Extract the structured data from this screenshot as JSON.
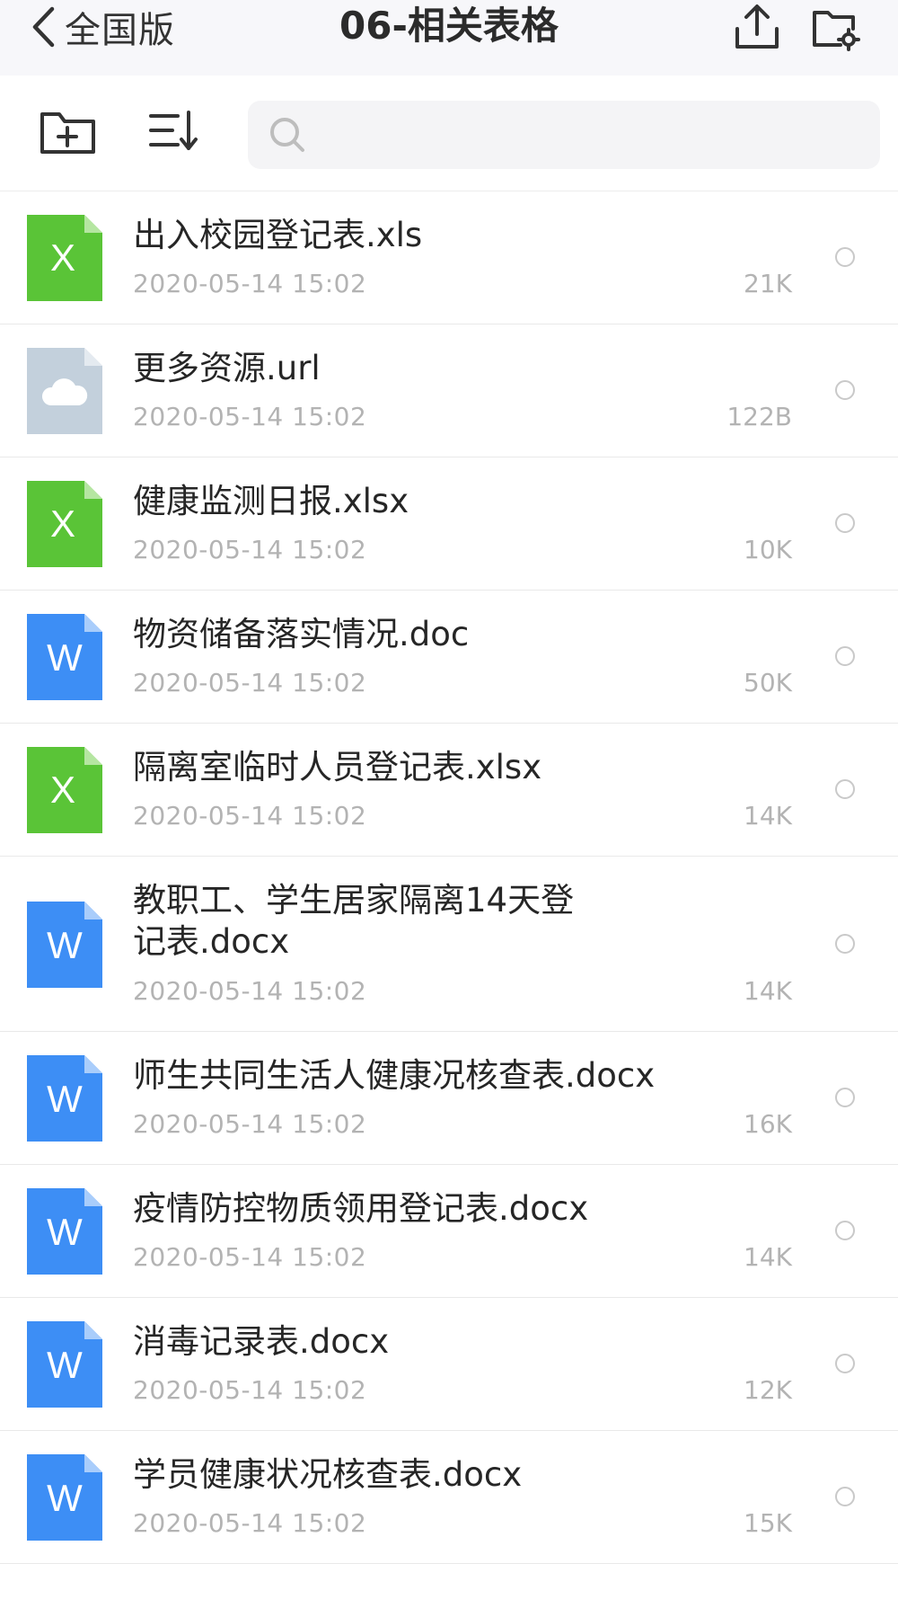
{
  "nav": {
    "back_label": "全国版",
    "title": "06-相关表格"
  },
  "search": {
    "placeholder": ""
  },
  "colors": {
    "excel": "#5ac437",
    "word": "#3d8ef5",
    "link": "#c3d0dc",
    "secondary_text": "#b3b3b3"
  },
  "files": [
    {
      "name": "出入校园登记表.xls",
      "date": "2020-05-14 15:02",
      "size": "21K",
      "type": "excel",
      "icon": "excel-file-icon"
    },
    {
      "name": "更多资源.url",
      "date": "2020-05-14 15:02",
      "size": "122B",
      "type": "link",
      "icon": "cloud-file-icon"
    },
    {
      "name": "健康监测日报.xlsx",
      "date": "2020-05-14 15:02",
      "size": "10K",
      "type": "excel",
      "icon": "excel-file-icon"
    },
    {
      "name": "物资储备落实情况.doc",
      "date": "2020-05-14 15:02",
      "size": "50K",
      "type": "word",
      "icon": "word-file-icon"
    },
    {
      "name": "隔离室临时人员登记表.xlsx",
      "date": "2020-05-14 15:02",
      "size": "14K",
      "type": "excel",
      "icon": "excel-file-icon"
    },
    {
      "name": "教职工、学生居家隔离14天登记表.docx",
      "date": "2020-05-14 15:02",
      "size": "14K",
      "type": "word",
      "icon": "word-file-icon"
    },
    {
      "name": "师生共同生活人健康况核查表.docx",
      "date": "2020-05-14 15:02",
      "size": "16K",
      "type": "word",
      "icon": "word-file-icon"
    },
    {
      "name": "疫情防控物质领用登记表.docx",
      "date": "2020-05-14 15:02",
      "size": "14K",
      "type": "word",
      "icon": "word-file-icon"
    },
    {
      "name": "消毒记录表.docx",
      "date": "2020-05-14 15:02",
      "size": "12K",
      "type": "word",
      "icon": "word-file-icon"
    },
    {
      "name": "学员健康状况核查表.docx",
      "date": "2020-05-14 15:02",
      "size": "15K",
      "type": "word",
      "icon": "word-file-icon"
    }
  ]
}
